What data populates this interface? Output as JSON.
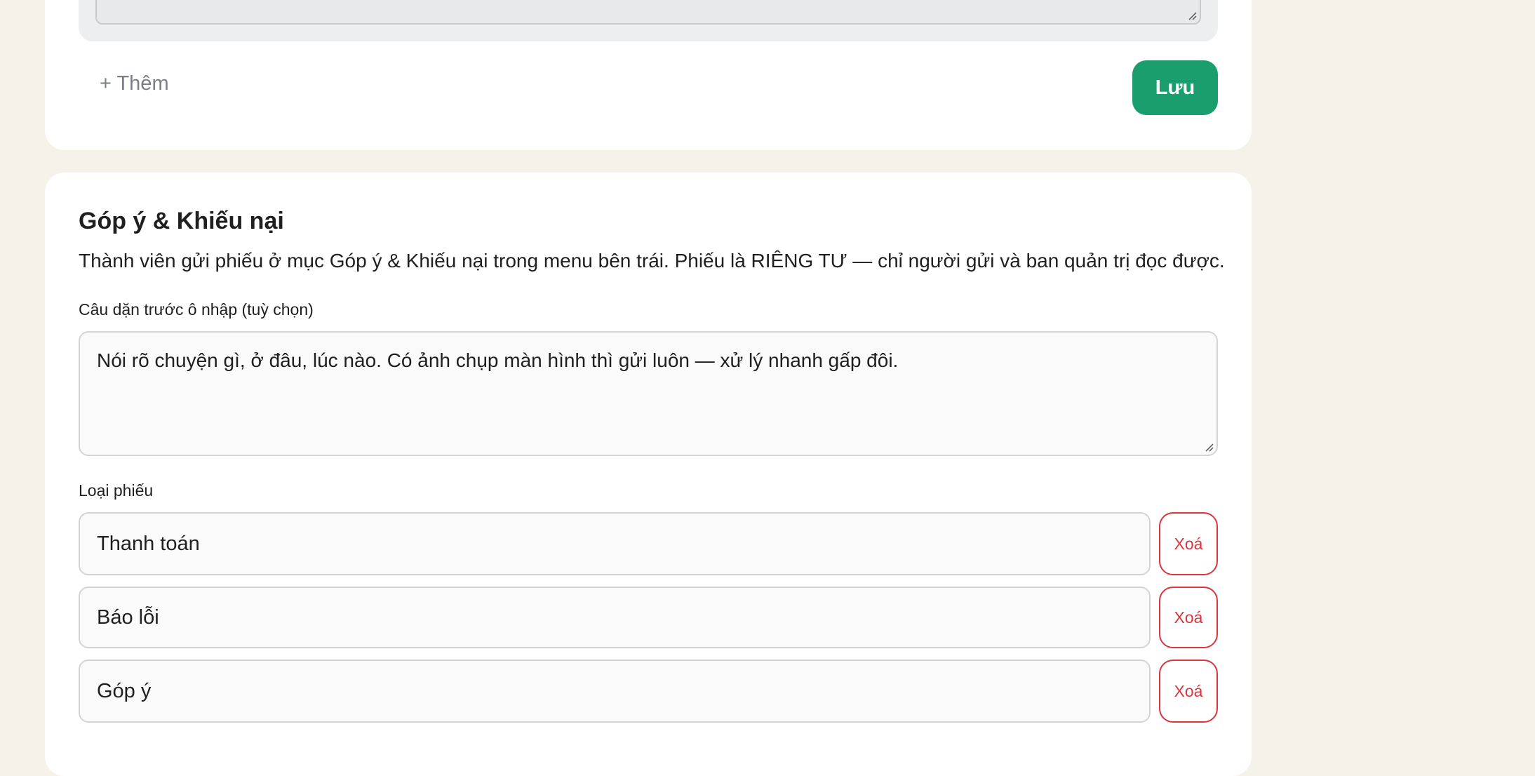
{
  "prev_section": {
    "add_label": "+ Thêm",
    "save_label": "Lưu"
  },
  "feedback_section": {
    "title": "Góp ý & Khiếu nại",
    "description": "Thành viên gửi phiếu ở mục Góp ý & Khiếu nại trong menu bên trái. Phiếu là RIÊNG TƯ — chỉ người gửi và ban quản trị đọc được.",
    "hint_label": "Câu dặn trước ô nhập (tuỳ chọn)",
    "hint_value": "Nói rõ chuyện gì, ở đâu, lúc nào. Có ảnh chụp màn hình thì gửi luôn — xử lý nhanh gấp đôi.",
    "types_label": "Loại phiếu",
    "ticket_types": [
      {
        "value": "Thanh toán",
        "delete_label": "Xoá"
      },
      {
        "value": "Báo lỗi",
        "delete_label": "Xoá"
      },
      {
        "value": "Góp ý",
        "delete_label": "Xoá"
      }
    ]
  },
  "colors": {
    "background": "#f4f2e9",
    "card": "#ffffff",
    "primary": "#1a9e6e",
    "danger": "#d9363e",
    "muted_text": "#7a7f86"
  },
  "icons": {
    "resize_grip": "resize-grip-icon"
  }
}
